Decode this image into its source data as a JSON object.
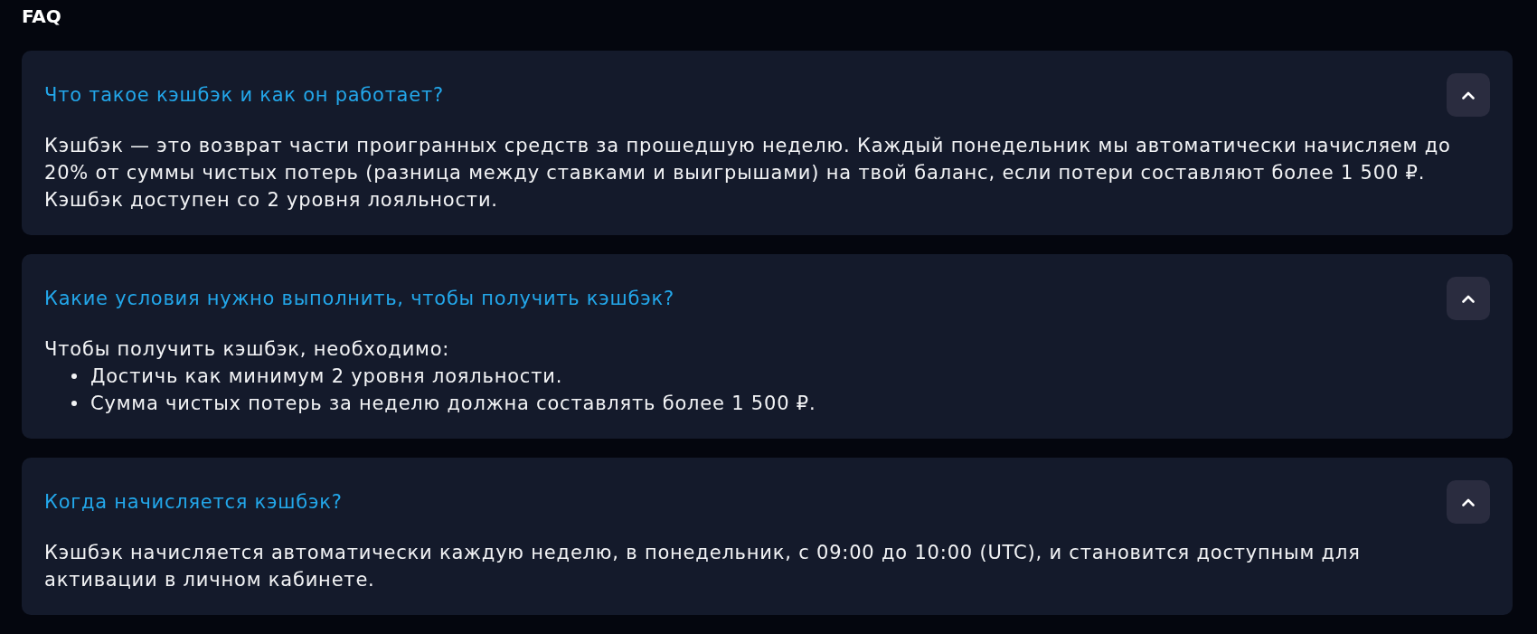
{
  "title": "FAQ",
  "items": [
    {
      "question": "Что такое кэшбэк и как он работает?",
      "expanded": true,
      "answer": [
        {
          "kind": "paragraph",
          "text": "Кэшбэк — это возврат части проигранных средств за прошедшую неделю. Каждый понедельник мы автоматически начисляем до 20% от суммы чистых потерь (разница между ставками и выигрышами) на твой баланс, если потери составляют более 1 500 ₽. Кэшбэк доступен со 2 уровня лояльности."
        }
      ]
    },
    {
      "question": "Какие условия нужно выполнить, чтобы получить кэшбэк?",
      "expanded": true,
      "answer": [
        {
          "kind": "paragraph",
          "text": "Чтобы получить кэшбэк, необходимо:"
        },
        {
          "kind": "list",
          "items": [
            "Достичь как минимум 2 уровня лояльности.",
            "Сумма чистых потерь за неделю должна составлять более 1 500 ₽."
          ]
        }
      ]
    },
    {
      "question": "Когда начисляется кэшбэк?",
      "expanded": true,
      "answer": [
        {
          "kind": "paragraph",
          "text": "Кэшбэк начисляется автоматически каждую неделю, в понедельник, с 09:00 до 10:00 (UTC), и становится доступным для\nактивации в личном кабинете."
        }
      ]
    }
  ]
}
